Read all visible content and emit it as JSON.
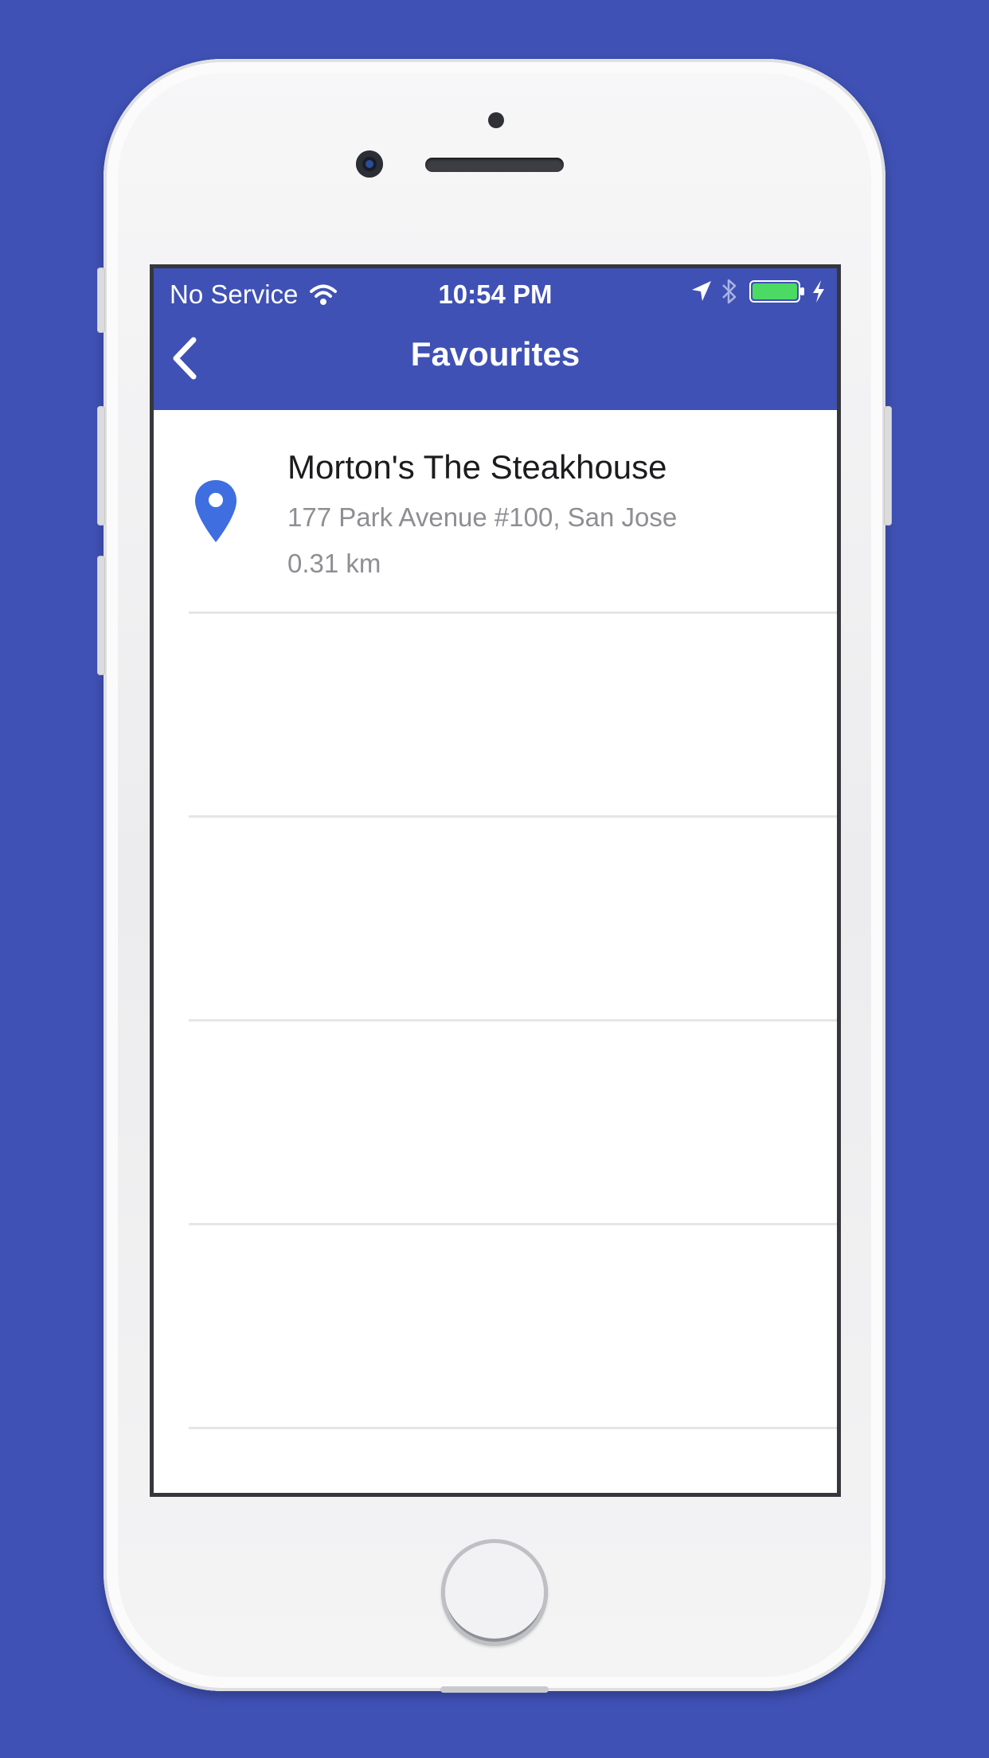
{
  "status_bar": {
    "carrier": "No Service",
    "time": "10:54 PM",
    "battery_color": "#4cd964"
  },
  "nav": {
    "title": "Favourites"
  },
  "favourites": [
    {
      "name": "Morton's The Steakhouse",
      "address": "177 Park Avenue #100, San Jose",
      "distance": "0.31 km"
    }
  ],
  "colors": {
    "primary": "#3f51b5",
    "pin": "#3f6ee0"
  },
  "icons": [
    "back-chevron-icon",
    "location-pin-icon",
    "wifi-icon",
    "location-arrow-icon",
    "bluetooth-icon",
    "battery-icon",
    "charging-bolt-icon"
  ]
}
